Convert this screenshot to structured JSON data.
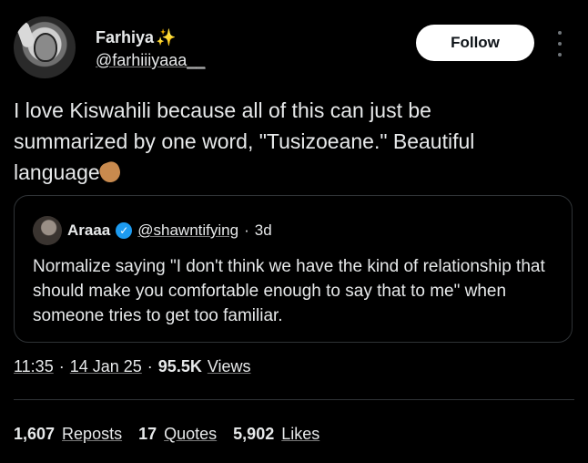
{
  "author": {
    "display_name": "Farhiya",
    "name_emoji": "✨",
    "handle": "@farhiiiyaaa__"
  },
  "follow_label": "Follow",
  "more_icon": "more-vertical-icon",
  "tweet": {
    "text": "I love Kiswahili because all of this can just be summarized by one word, \"Tusizoeane.\" Beautiful language",
    "emoji": "clapping-hands"
  },
  "quoted": {
    "name": "Araaa",
    "verified": true,
    "handle": "@shawntifying",
    "separator": "·",
    "time": "3d",
    "text": "Normalize saying \"I don't think we have the kind of relationship that should make you comfortable enough to say that to me\" when someone tries to get too familiar."
  },
  "meta": {
    "time": "11:35",
    "separator": "·",
    "date": "14 Jan 25",
    "views_count": "95.5K",
    "views_label": "Views"
  },
  "stats": [
    {
      "count": "1,607",
      "label": "Reposts"
    },
    {
      "count": "17",
      "label": "Quotes"
    },
    {
      "count": "5,902",
      "label": "Likes"
    }
  ],
  "colors": {
    "background": "#000000",
    "text": "#e7e9ea",
    "border": "#2f3336",
    "verified": "#1d9bf0",
    "button_bg": "#ffffff"
  }
}
